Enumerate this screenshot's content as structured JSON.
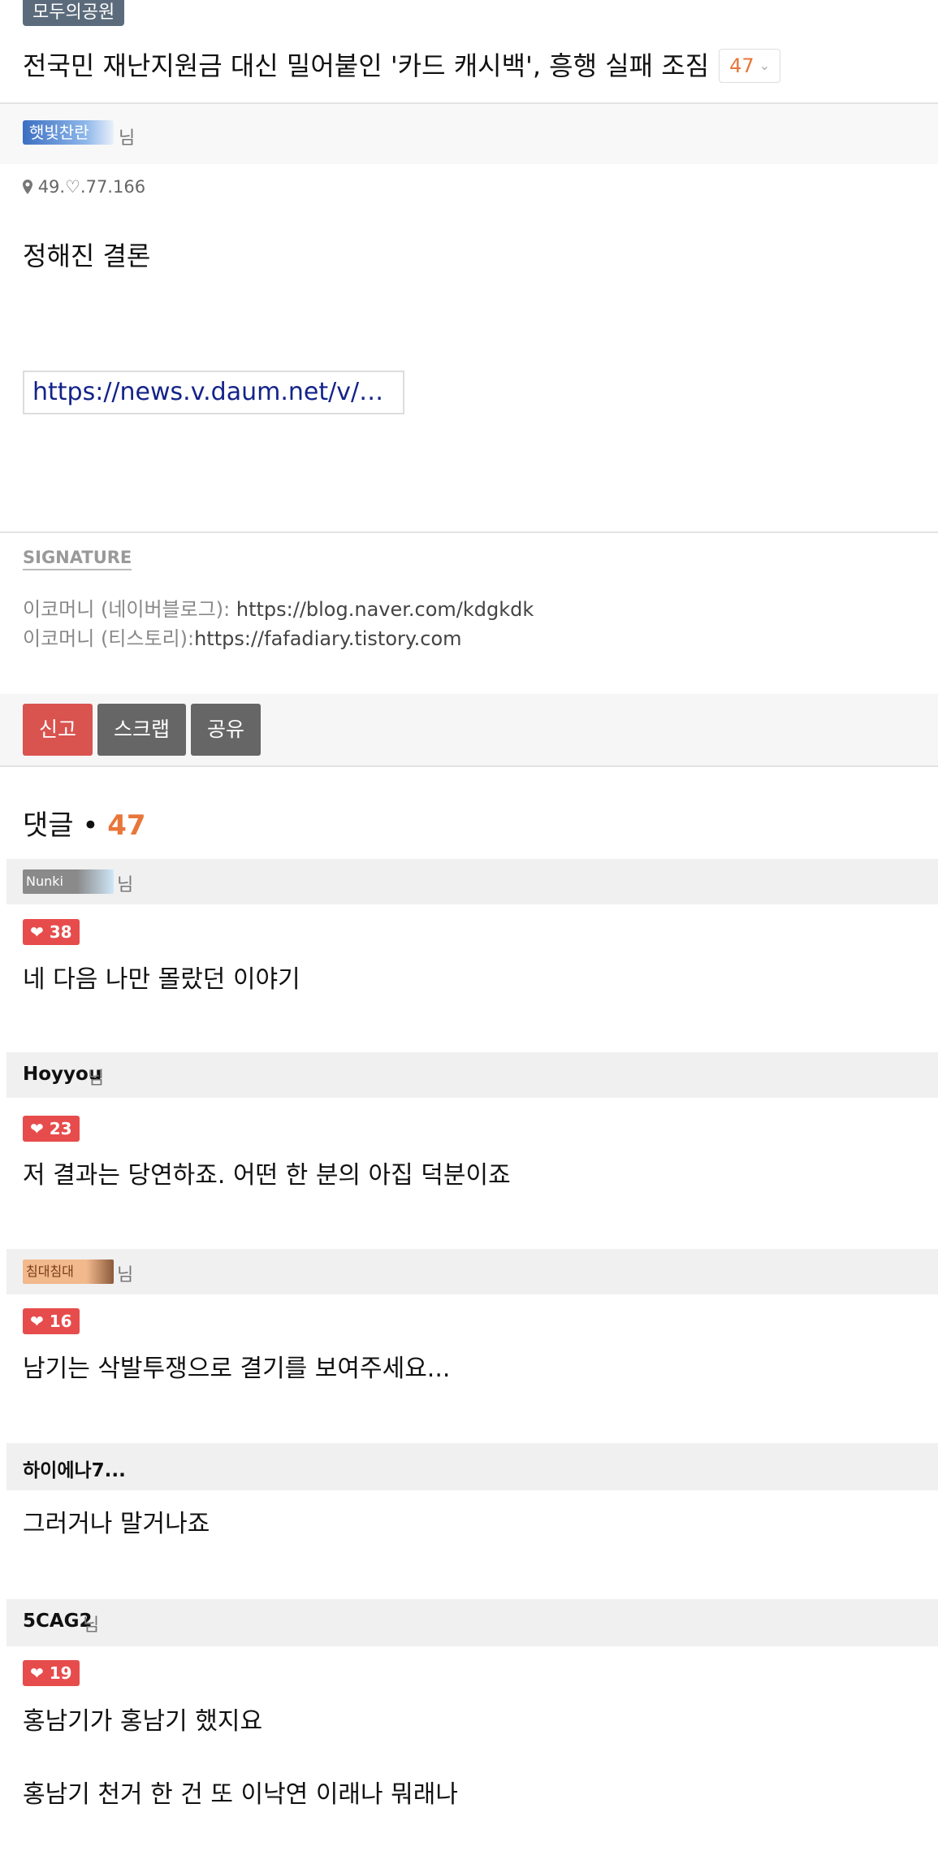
{
  "post": {
    "board": "모두의공원",
    "title": "전국민 재난지원금 대신 밀어붙인 '카드 캐시백', 흥행 실패 조짐",
    "comment_count": "47",
    "author_nickname": "햇빛찬란",
    "author_suffix": "님",
    "ip": "49.♡.77.166",
    "body": "정해진 결론",
    "link": "https://news.v.daum.net/v/2..."
  },
  "signature": {
    "label": "SIGNATURE",
    "line1_prefix": "이코머니 (네이버블로그): ",
    "line1_url": "https://blog.naver.com/kdgkdk",
    "line2_prefix": "이코머니 (티스토리):",
    "line2_url": "https://fafadiary.tistory.com"
  },
  "actions": {
    "report": "신고",
    "scrap": "스크랩",
    "share": "공유"
  },
  "comments_header": {
    "label": "댓글 • ",
    "count": "47"
  },
  "comments": [
    {
      "name": "Nunki",
      "name_is_image": true,
      "suffix": "님",
      "likes": "38",
      "text": "네 다음 나만 몰랐던 이야기"
    },
    {
      "name": "Hoyyou",
      "suffix": "님",
      "likes": "23",
      "text": "저 결과는 당연하죠. 어떤 한 분의 아집 덕분이죠"
    },
    {
      "name": "침대침대",
      "name_is_image": true,
      "suffix": "님",
      "likes": "16",
      "text": "남기는 삭발투쟁으로 결기를 보여주세요..."
    },
    {
      "name": "하이에나7...",
      "suffix": "",
      "likes": "",
      "text": "그러거나 말거나죠"
    },
    {
      "name": "5CAG2",
      "suffix": "님",
      "likes": "19",
      "text": "홍남기가 홍남기 했지요",
      "text2": "홍남기 천거 한 건 또 이낙연 이래나 뭐래나"
    }
  ]
}
